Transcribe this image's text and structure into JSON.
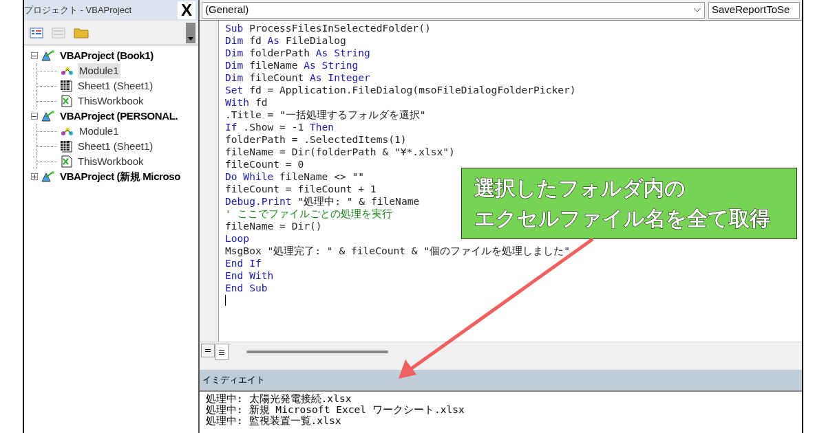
{
  "project_panel": {
    "title": "プロジェクト - VBAProject",
    "close": "X",
    "tree": [
      {
        "label": "VBAProject (Book1)",
        "kind": "project",
        "expanded": true,
        "children": [
          {
            "label": "Module1",
            "kind": "module",
            "selected": true
          },
          {
            "label": "Sheet1 (Sheet1)",
            "kind": "sheet",
            "selected": false
          },
          {
            "label": "ThisWorkbook",
            "kind": "workbook",
            "selected": false
          }
        ]
      },
      {
        "label": "VBAProject (PERSONAL.",
        "kind": "project",
        "expanded": true,
        "children": [
          {
            "label": "Module1",
            "kind": "module",
            "selected": false
          },
          {
            "label": "Sheet1 (Sheet1)",
            "kind": "sheet",
            "selected": false
          },
          {
            "label": "ThisWorkbook",
            "kind": "workbook",
            "selected": false
          }
        ]
      },
      {
        "label": "VBAProject (新規 Microso",
        "kind": "project",
        "expanded": false
      }
    ]
  },
  "code_window": {
    "object_dropdown": "(General)",
    "procedure_dropdown": "SaveReportToSe",
    "lines": [
      [
        {
          "kind": "keyword",
          "text": "Sub"
        },
        {
          "kind": "plain",
          "text": " ProcessFilesInSelectedFolder()"
        }
      ],
      [
        {
          "kind": "keyword",
          "text": "Dim"
        },
        {
          "kind": "plain",
          "text": " fd "
        },
        {
          "kind": "keyword",
          "text": "As"
        },
        {
          "kind": "plain",
          "text": " FileDialog"
        }
      ],
      [
        {
          "kind": "keyword",
          "text": "Dim"
        },
        {
          "kind": "plain",
          "text": " folderPath "
        },
        {
          "kind": "keyword",
          "text": "As String"
        }
      ],
      [
        {
          "kind": "keyword",
          "text": "Dim"
        },
        {
          "kind": "plain",
          "text": " fileName "
        },
        {
          "kind": "keyword",
          "text": "As String"
        }
      ],
      [
        {
          "kind": "keyword",
          "text": "Dim"
        },
        {
          "kind": "plain",
          "text": " fileCount "
        },
        {
          "kind": "keyword",
          "text": "As Integer"
        }
      ],
      [
        {
          "kind": "keyword",
          "text": "Set"
        },
        {
          "kind": "plain",
          "text": " fd = Application.FileDialog(msoFileDialogFolderPicker)"
        }
      ],
      [
        {
          "kind": "keyword",
          "text": "With"
        },
        {
          "kind": "plain",
          "text": " fd"
        }
      ],
      [
        {
          "kind": "plain",
          "text": ".Title = \"一括処理するフォルダを選択\""
        }
      ],
      [
        {
          "kind": "keyword",
          "text": "If"
        },
        {
          "kind": "plain",
          "text": " .Show = -1 "
        },
        {
          "kind": "keyword",
          "text": "Then"
        }
      ],
      [
        {
          "kind": "plain",
          "text": "folderPath = .SelectedItems(1)"
        }
      ],
      [
        {
          "kind": "plain",
          "text": "fileName = Dir(folderPath & \"¥*.xlsx\")"
        }
      ],
      [
        {
          "kind": "plain",
          "text": "fileCount = 0"
        }
      ],
      [
        {
          "kind": "keyword",
          "text": "Do While"
        },
        {
          "kind": "plain",
          "text": " fileName <> \"\""
        }
      ],
      [
        {
          "kind": "plain",
          "text": "fileCount = fileCount + 1"
        }
      ],
      [
        {
          "kind": "keyword",
          "text": "Debug.Print"
        },
        {
          "kind": "plain",
          "text": " \"処理中: \" & fileName"
        }
      ],
      [
        {
          "kind": "comment",
          "text": "' ここでファイルごとの処理を実行"
        }
      ],
      [
        {
          "kind": "plain",
          "text": "fileName = Dir()"
        }
      ],
      [
        {
          "kind": "keyword",
          "text": "Loop"
        }
      ],
      [
        {
          "kind": "plain",
          "text": "MsgBox \"処理完了: \" & fileCount & \"個のファイルを処理しました\""
        }
      ],
      [
        {
          "kind": "keyword",
          "text": "End If"
        }
      ],
      [
        {
          "kind": "keyword",
          "text": "End With"
        }
      ],
      [
        {
          "kind": "keyword",
          "text": "End Sub"
        }
      ]
    ]
  },
  "callout": {
    "lines": [
      "選択したフォルダ内の",
      "エクセルファイル名を全て取得"
    ]
  },
  "immediate_window": {
    "title": "イミディエイト",
    "lines": [
      "処理中: 太陽光発電接続.xlsx",
      "処理中: 新規 Microsoft Excel ワークシート.xlsx",
      "処理中: 監視装置一覧.xlsx"
    ]
  }
}
